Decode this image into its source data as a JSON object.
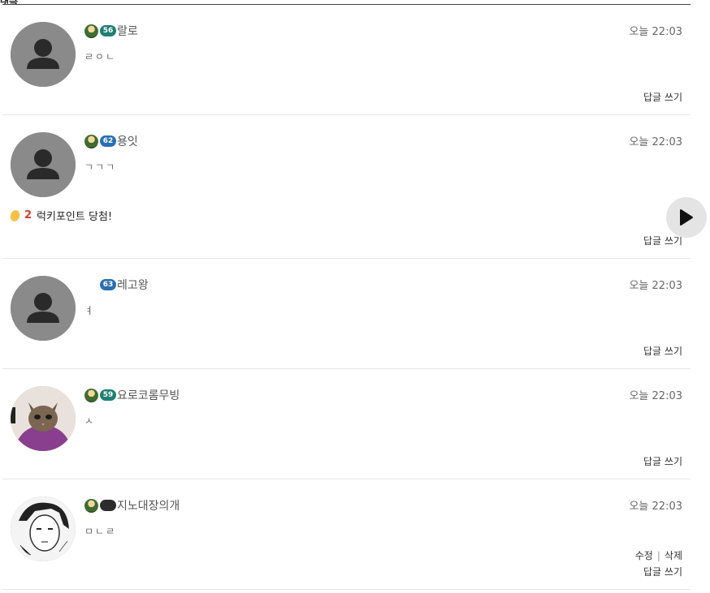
{
  "header": {
    "title_fragment": "댓글"
  },
  "comments": [
    {
      "level": "56",
      "level_color": "#1f7f73",
      "rank_badge": "green-helmet",
      "name": "랄로",
      "time": "오늘 22:03",
      "body": "ㄹㅇㄴ",
      "reply_label": "답글 쓰기",
      "avatar": "default-avatar"
    },
    {
      "level": "62",
      "level_color": "#2a6fb0",
      "rank_badge": "green-helmet",
      "name": "용잇",
      "time": "오늘 22:03",
      "body": "ㄱㄱㄱ",
      "lucky": {
        "count": "2",
        "text": "럭키포인트 당첨!"
      },
      "reply_label": "답글 쓰기",
      "avatar": "default-avatar"
    },
    {
      "level": "63",
      "level_color": "#2a6fb0",
      "rank_badge": "none",
      "name": "레고왕",
      "time": "오늘 22:03",
      "body": "ㅕ",
      "reply_label": "답글 쓰기",
      "avatar": "default-avatar"
    },
    {
      "level": "59",
      "level_color": "#1f7f73",
      "rank_badge": "green-helmet",
      "name": "요로코롬무빙",
      "time": "오늘 22:03",
      "body": "ㅅ",
      "reply_label": "답글 쓰기",
      "avatar": "cat-photo"
    },
    {
      "level": "",
      "level_color": "#2c2c2c",
      "rank_badge": "green-helmet",
      "name": "지노대장의개",
      "time": "오늘 22:03",
      "body": "ㅁㄴㄹ",
      "edit_label": "수정",
      "delete_label": "삭제",
      "reply_label": "답글 쓰기",
      "avatar": "manga-drawing"
    }
  ],
  "icons": {
    "next": "play-arrow-icon"
  }
}
